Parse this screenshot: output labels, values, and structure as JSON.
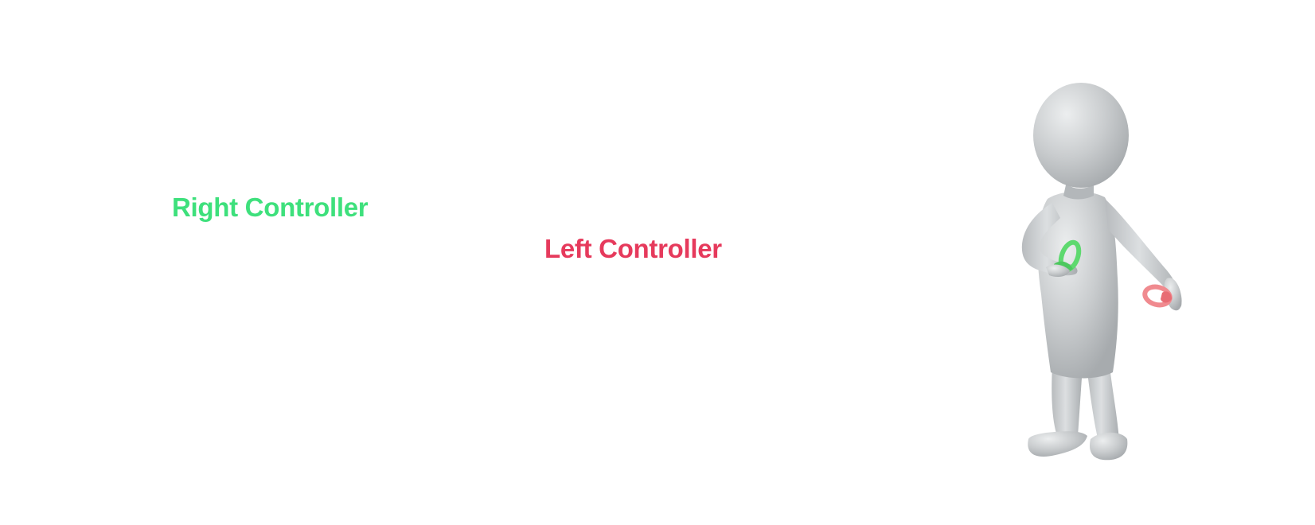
{
  "labels": {
    "right_controller": "Right Controller",
    "left_controller": "Left Controller"
  },
  "colors": {
    "right_controller": "#3ee07c",
    "left_controller": "#e63a5c",
    "figure": "#c9ccce"
  },
  "figure": {
    "icon": "person-with-controllers-icon"
  }
}
